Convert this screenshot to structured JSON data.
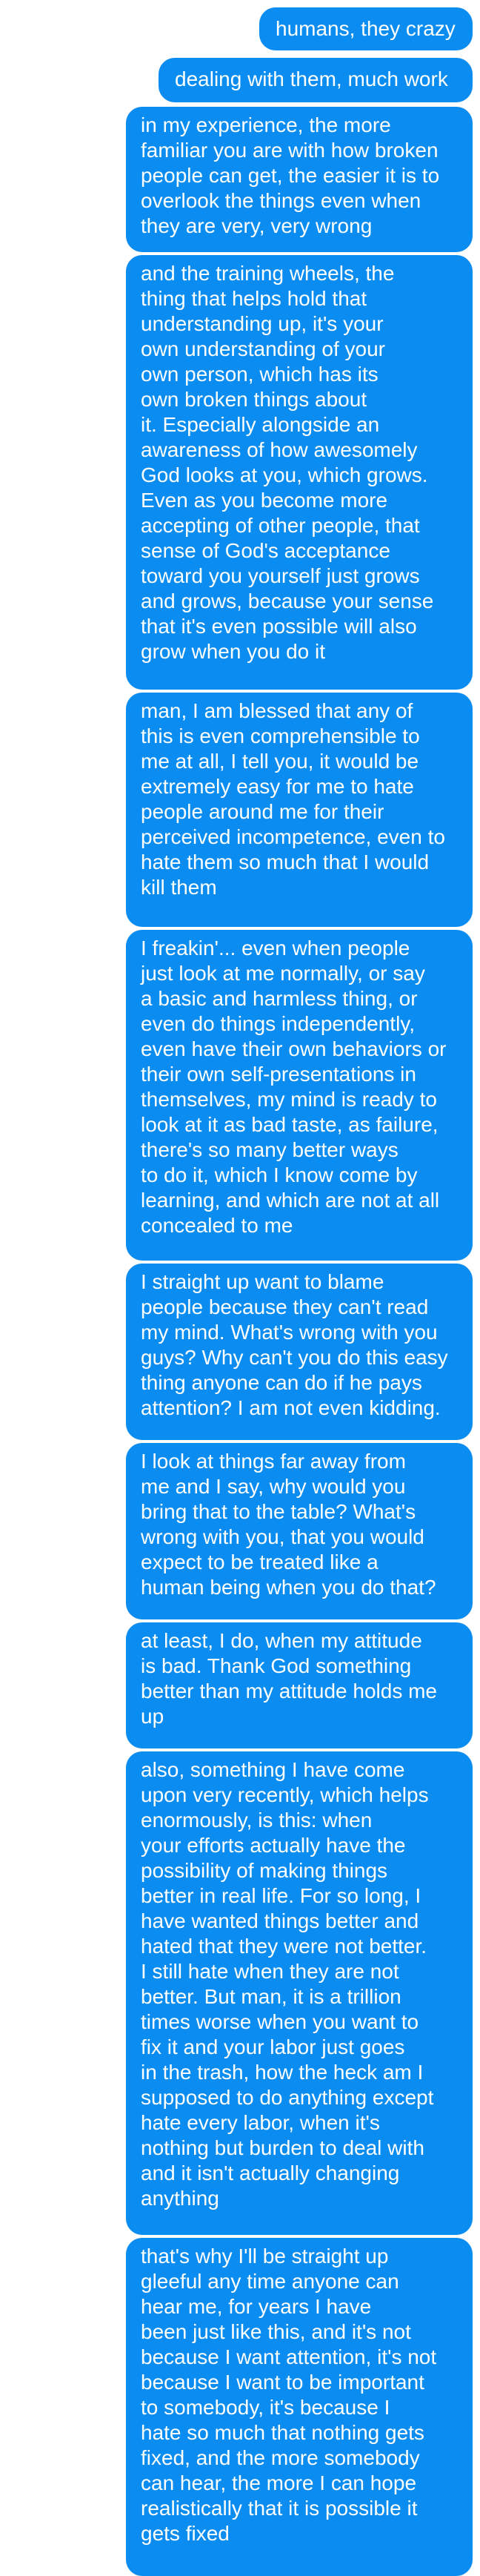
{
  "conversation": {
    "messages": [
      {
        "text": "humans, they crazy"
      },
      {
        "text": "dealing with them, much work"
      },
      {
        "text": "in my experience, the more\nfamiliar you are with how broken\npeople can get, the easier it is to\noverlook the things even when\nthey are very, very wrong"
      },
      {
        "text": "and the training wheels, the\nthing that helps hold that\nunderstanding up, it's your\nown understanding of your\nown person, which has its\nown broken things about\nit. Especially alongside an\nawareness of how awesomely\nGod looks at you, which grows.\nEven as you become more\naccepting of other people, that\nsense of God's acceptance\ntoward you yourself just grows\nand grows, because your sense\nthat it's even possible will also\ngrow when you do it"
      },
      {
        "text": "man, I am blessed that any of\nthis is even comprehensible to\nme at all, I tell you, it would be\nextremely easy for me to hate\npeople around me for their\nperceived incompetence, even to\nhate them so much that I would\nkill them"
      },
      {
        "text": "I freakin'... even when people\njust look at me normally, or say\na basic and harmless thing, or\neven do things independently,\neven have their own behaviors or\ntheir own self-presentations in\nthemselves, my mind is ready to\nlook at it as bad taste, as failure,\nthere's so many better ways\nto do it, which I know come by\nlearning, and which are not at all\nconcealed to me"
      },
      {
        "text": "I straight up want to blame\npeople because they can't read\nmy mind. What's wrong with you\nguys? Why can't you do this easy\nthing anyone can do if he pays\nattention? I am not even kidding."
      },
      {
        "text": "I look at things far away from\nme and I say, why would you\nbring that to the table? What's\nwrong with you, that you would\nexpect to be treated like a\nhuman being when you do that?"
      },
      {
        "text": "at least, I do, when my attitude\nis bad. Thank God something\nbetter than my attitude holds me\nup"
      },
      {
        "text": "also, something I have come\nupon very recently, which helps\nenormously, is this: when\nyour efforts actually have the\npossibility of making things\nbetter in real life. For so long, I\nhave wanted things better and\nhated that they were not better.\nI still hate when they are not\nbetter. But man, it is a trillion\ntimes worse when you want to\nfix it and your labor just goes\nin the trash, how the heck am I\nsupposed to do anything except\nhate every labor, when it's\nnothing but burden to deal with\nand it isn't actually changing\nanything"
      },
      {
        "text": "that's why I'll be straight up\ngleeful any time anyone can\nhear me, for years I have\nbeen just like this, and it's not\nbecause I want attention, it's not\nbecause I want to be important\nto somebody, it's because I\nhate so much that nothing gets\nfixed, and the more somebody\ncan hear, the more I can hope\nrealistically that it is possible it\ngets fixed"
      }
    ]
  },
  "colors": {
    "bubble_background": "#0a8cf0",
    "bubble_text": "#ffffff",
    "page_background": "#ffffff"
  }
}
